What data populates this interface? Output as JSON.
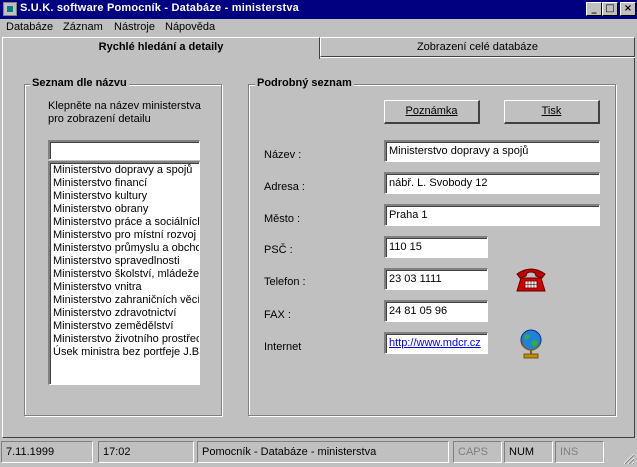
{
  "window": {
    "title": "S.U.K. software  Pomocník - Databáze - ministerstva",
    "minimize": "_",
    "maximize": "□",
    "close": "×"
  },
  "menu": [
    {
      "label": "Databáze"
    },
    {
      "label": "Záznam"
    },
    {
      "label": "Nástroje"
    },
    {
      "label": "Nápověda"
    }
  ],
  "tabs": {
    "quick": "Rychlé hledání a detaily",
    "full": "Zobrazení celé databáze"
  },
  "left_panel": {
    "group_title": "Seznam dle názvu",
    "hint_line1": "Klepněte na název ministerstva",
    "hint_line2": "pro zobrazení detailu",
    "search_value": "",
    "items": [
      "Ministerstvo dopravy a spojů",
      "Ministerstvo financí",
      "Ministerstvo kultury",
      "Ministerstvo obrany",
      "Ministerstvo práce a sociálních",
      "Ministerstvo pro místní rozvoj",
      "Ministerstvo průmyslu a obchod",
      "Ministerstvo spravedlnosti",
      "Ministerstvo školství, mládeže a",
      "Ministerstvo vnitra",
      "Ministerstvo zahraničních věcí",
      "Ministerstvo zdravotnictví",
      "Ministerstvo zemědělství",
      "Ministerstvo životního prostředí",
      "Úsek ministra bez portfeje J.Ba"
    ]
  },
  "right_panel": {
    "group_title": "Podrobný seznam",
    "note_button": "Poznámka",
    "print_button": "Tisk",
    "fields": {
      "name_label": "Název :",
      "name_value": "Ministerstvo dopravy a spojů",
      "address_label": "Adresa :",
      "address_value": "nábř. L. Svobody 12",
      "city_label": "Město :",
      "city_value": "Praha 1",
      "zip_label": "PSČ :",
      "zip_value": "110 15",
      "phone_label": "Telefon :",
      "phone_value": "23 03 1111",
      "fax_label": "FAX :",
      "fax_value": "24 81 05 96",
      "internet_label": "Internet",
      "internet_value": "http://www.mdcr.cz"
    }
  },
  "statusbar": {
    "date": "7.11.1999",
    "time": "17:02",
    "context": "Pomocník - Databáze - ministerstva",
    "caps": "CAPS",
    "num": "NUM",
    "ins": "INS"
  },
  "colors": {
    "titlebar": "#000080",
    "face": "#c0c0c0",
    "link": "#0000ff",
    "phone_icon": "#c00000"
  }
}
